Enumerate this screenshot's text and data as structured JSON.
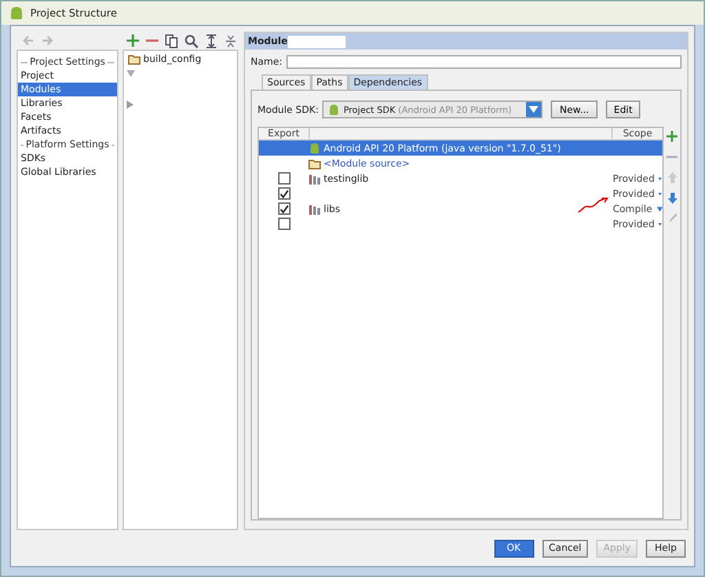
{
  "window": {
    "title": "Project Structure"
  },
  "sidebar": {
    "sections": [
      {
        "heading": "Project Settings",
        "items": [
          {
            "label": "Project",
            "selected": false
          },
          {
            "label": "Modules",
            "selected": true
          },
          {
            "label": "Libraries",
            "selected": false
          },
          {
            "label": "Facets",
            "selected": false
          },
          {
            "label": "Artifacts",
            "selected": false
          }
        ]
      },
      {
        "heading": "Platform Settings",
        "items": [
          {
            "label": "SDKs",
            "selected": false
          },
          {
            "label": "Global Libraries",
            "selected": false
          }
        ]
      }
    ]
  },
  "tree": {
    "items": [
      {
        "label": "build_config",
        "selected": false
      }
    ]
  },
  "module": {
    "header": "Module",
    "name_label": "Name:",
    "tabs": [
      {
        "label": "Sources",
        "selected": false
      },
      {
        "label": "Paths",
        "selected": false
      },
      {
        "label": "Dependencies",
        "selected": true
      }
    ],
    "sdk_label": "Module SDK:",
    "sdk_value": "Project SDK",
    "sdk_hint": "(Android API 20 Platform)",
    "new_button": "New...",
    "edit_button": "Edit",
    "columns": [
      "Export",
      "Scope"
    ],
    "rows": [
      {
        "kind": "sdk",
        "name": "Android API 20 Platform (java version \"1.7.0_51\")",
        "selected": true
      },
      {
        "kind": "source",
        "name": "<Module source>",
        "selected": false
      },
      {
        "kind": "library",
        "name": "testinglib",
        "export": false,
        "scope": "Provided",
        "selected": false
      },
      {
        "kind": "library",
        "export": true,
        "scope": "Provided",
        "selected": false
      },
      {
        "kind": "library",
        "name": "libs",
        "export": true,
        "scope": "Compile",
        "selected": false
      },
      {
        "kind": "library",
        "export": false,
        "scope": "Provided",
        "selected": false
      }
    ]
  },
  "buttons": [
    {
      "label": "OK",
      "kind": "primary",
      "disabled": false
    },
    {
      "label": "Cancel",
      "kind": "normal",
      "disabled": false
    },
    {
      "label": "Apply",
      "kind": "normal",
      "disabled": true
    },
    {
      "label": "Help",
      "kind": "normal",
      "disabled": false
    }
  ]
}
